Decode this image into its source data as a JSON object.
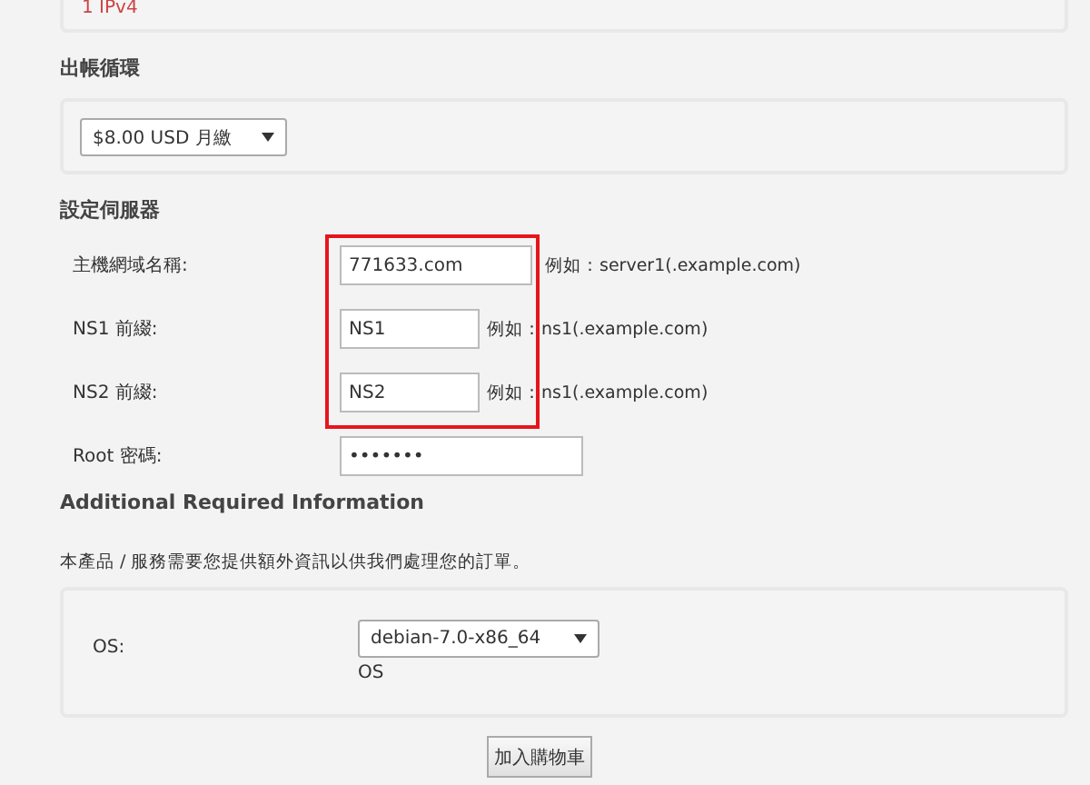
{
  "top_panel": {
    "text": "1 IPv4"
  },
  "billing": {
    "heading": "出帳循環",
    "cycle": "$8.00 USD 月繳"
  },
  "server": {
    "heading": "設定伺服器",
    "fields": [
      {
        "label": "主機網域名稱:",
        "value": "771633.com",
        "hint": "例如：server1(.example.com)",
        "kind": "wide"
      },
      {
        "label": "NS1 前綴:",
        "value": "NS1",
        "hint": "例如：ns1(.example.com)",
        "kind": "short"
      },
      {
        "label": "NS2 前綴:",
        "value": "NS2",
        "hint": "例如：ns1(.example.com)",
        "kind": "short"
      },
      {
        "label": "Root 密碼:",
        "value": "•••••••",
        "kind": "password"
      }
    ]
  },
  "additional": {
    "heading": "Additional Required Information",
    "note": "本產品 / 服務需要您提供額外資訊以供我們處理您的訂單。",
    "os": {
      "label": "OS:",
      "value": "debian-7.0-x86_64",
      "description": "OS"
    }
  },
  "button": "加入購物車"
}
